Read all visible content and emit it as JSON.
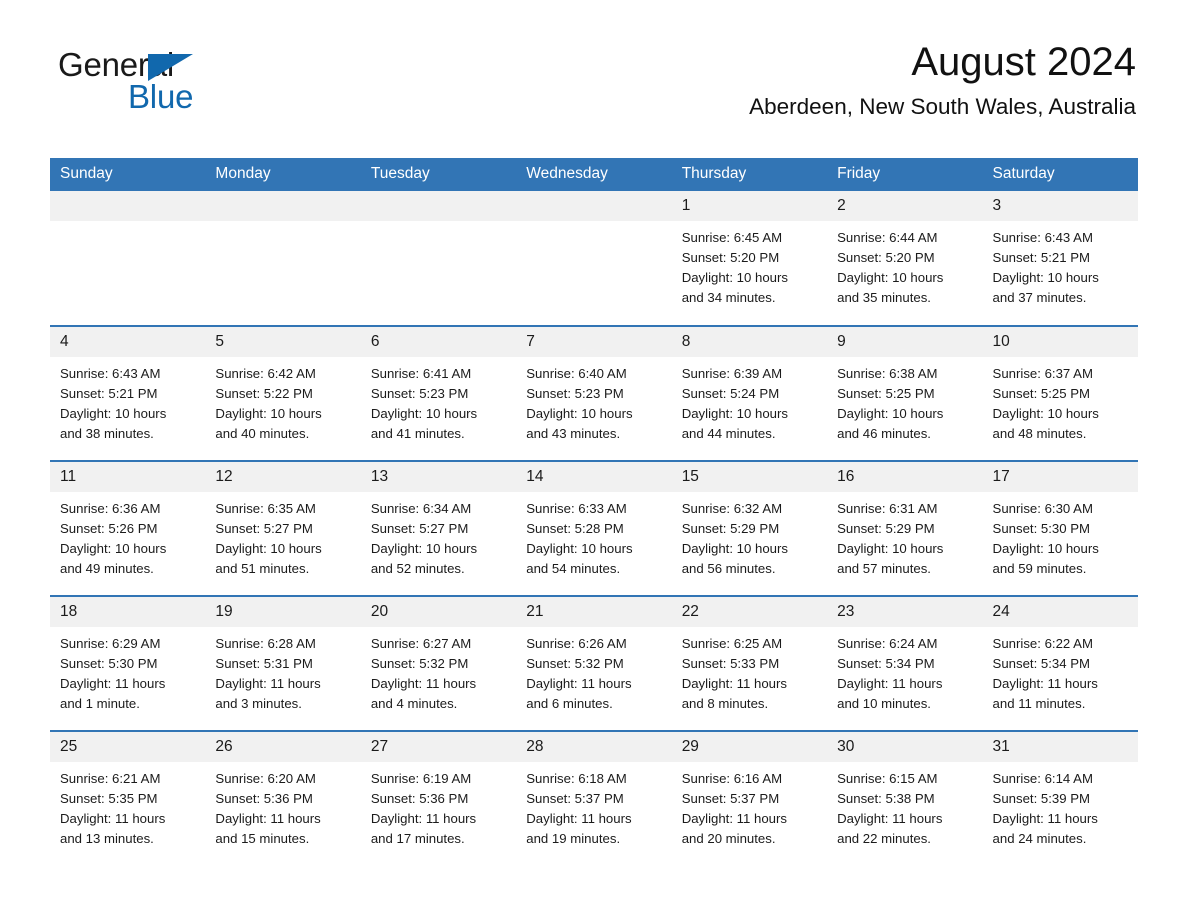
{
  "brand": {
    "name_part1": "General",
    "name_part2": "Blue",
    "accent_color": "#1168ad",
    "triangle_icon": "triangle-icon"
  },
  "header": {
    "month_title": "August 2024",
    "location": "Aberdeen, New South Wales, Australia"
  },
  "theme": {
    "header_blue": "#3275b5",
    "row_divider_blue": "#3275b5",
    "daynum_band": "#f1f1f1",
    "text": "#1b1b1b"
  },
  "calendar": {
    "weekday_headers": [
      "Sunday",
      "Monday",
      "Tuesday",
      "Wednesday",
      "Thursday",
      "Friday",
      "Saturday"
    ],
    "weeks": [
      [
        {
          "day": "",
          "empty": true,
          "sunrise": "",
          "sunset": "",
          "daylight_line1": "",
          "daylight_line2": ""
        },
        {
          "day": "",
          "empty": true,
          "sunrise": "",
          "sunset": "",
          "daylight_line1": "",
          "daylight_line2": ""
        },
        {
          "day": "",
          "empty": true,
          "sunrise": "",
          "sunset": "",
          "daylight_line1": "",
          "daylight_line2": ""
        },
        {
          "day": "",
          "empty": true,
          "sunrise": "",
          "sunset": "",
          "daylight_line1": "",
          "daylight_line2": ""
        },
        {
          "day": "1",
          "empty": false,
          "sunrise": "Sunrise: 6:45 AM",
          "sunset": "Sunset: 5:20 PM",
          "daylight_line1": "Daylight: 10 hours",
          "daylight_line2": "and 34 minutes."
        },
        {
          "day": "2",
          "empty": false,
          "sunrise": "Sunrise: 6:44 AM",
          "sunset": "Sunset: 5:20 PM",
          "daylight_line1": "Daylight: 10 hours",
          "daylight_line2": "and 35 minutes."
        },
        {
          "day": "3",
          "empty": false,
          "sunrise": "Sunrise: 6:43 AM",
          "sunset": "Sunset: 5:21 PM",
          "daylight_line1": "Daylight: 10 hours",
          "daylight_line2": "and 37 minutes."
        }
      ],
      [
        {
          "day": "4",
          "empty": false,
          "sunrise": "Sunrise: 6:43 AM",
          "sunset": "Sunset: 5:21 PM",
          "daylight_line1": "Daylight: 10 hours",
          "daylight_line2": "and 38 minutes."
        },
        {
          "day": "5",
          "empty": false,
          "sunrise": "Sunrise: 6:42 AM",
          "sunset": "Sunset: 5:22 PM",
          "daylight_line1": "Daylight: 10 hours",
          "daylight_line2": "and 40 minutes."
        },
        {
          "day": "6",
          "empty": false,
          "sunrise": "Sunrise: 6:41 AM",
          "sunset": "Sunset: 5:23 PM",
          "daylight_line1": "Daylight: 10 hours",
          "daylight_line2": "and 41 minutes."
        },
        {
          "day": "7",
          "empty": false,
          "sunrise": "Sunrise: 6:40 AM",
          "sunset": "Sunset: 5:23 PM",
          "daylight_line1": "Daylight: 10 hours",
          "daylight_line2": "and 43 minutes."
        },
        {
          "day": "8",
          "empty": false,
          "sunrise": "Sunrise: 6:39 AM",
          "sunset": "Sunset: 5:24 PM",
          "daylight_line1": "Daylight: 10 hours",
          "daylight_line2": "and 44 minutes."
        },
        {
          "day": "9",
          "empty": false,
          "sunrise": "Sunrise: 6:38 AM",
          "sunset": "Sunset: 5:25 PM",
          "daylight_line1": "Daylight: 10 hours",
          "daylight_line2": "and 46 minutes."
        },
        {
          "day": "10",
          "empty": false,
          "sunrise": "Sunrise: 6:37 AM",
          "sunset": "Sunset: 5:25 PM",
          "daylight_line1": "Daylight: 10 hours",
          "daylight_line2": "and 48 minutes."
        }
      ],
      [
        {
          "day": "11",
          "empty": false,
          "sunrise": "Sunrise: 6:36 AM",
          "sunset": "Sunset: 5:26 PM",
          "daylight_line1": "Daylight: 10 hours",
          "daylight_line2": "and 49 minutes."
        },
        {
          "day": "12",
          "empty": false,
          "sunrise": "Sunrise: 6:35 AM",
          "sunset": "Sunset: 5:27 PM",
          "daylight_line1": "Daylight: 10 hours",
          "daylight_line2": "and 51 minutes."
        },
        {
          "day": "13",
          "empty": false,
          "sunrise": "Sunrise: 6:34 AM",
          "sunset": "Sunset: 5:27 PM",
          "daylight_line1": "Daylight: 10 hours",
          "daylight_line2": "and 52 minutes."
        },
        {
          "day": "14",
          "empty": false,
          "sunrise": "Sunrise: 6:33 AM",
          "sunset": "Sunset: 5:28 PM",
          "daylight_line1": "Daylight: 10 hours",
          "daylight_line2": "and 54 minutes."
        },
        {
          "day": "15",
          "empty": false,
          "sunrise": "Sunrise: 6:32 AM",
          "sunset": "Sunset: 5:29 PM",
          "daylight_line1": "Daylight: 10 hours",
          "daylight_line2": "and 56 minutes."
        },
        {
          "day": "16",
          "empty": false,
          "sunrise": "Sunrise: 6:31 AM",
          "sunset": "Sunset: 5:29 PM",
          "daylight_line1": "Daylight: 10 hours",
          "daylight_line2": "and 57 minutes."
        },
        {
          "day": "17",
          "empty": false,
          "sunrise": "Sunrise: 6:30 AM",
          "sunset": "Sunset: 5:30 PM",
          "daylight_line1": "Daylight: 10 hours",
          "daylight_line2": "and 59 minutes."
        }
      ],
      [
        {
          "day": "18",
          "empty": false,
          "sunrise": "Sunrise: 6:29 AM",
          "sunset": "Sunset: 5:30 PM",
          "daylight_line1": "Daylight: 11 hours",
          "daylight_line2": "and 1 minute."
        },
        {
          "day": "19",
          "empty": false,
          "sunrise": "Sunrise: 6:28 AM",
          "sunset": "Sunset: 5:31 PM",
          "daylight_line1": "Daylight: 11 hours",
          "daylight_line2": "and 3 minutes."
        },
        {
          "day": "20",
          "empty": false,
          "sunrise": "Sunrise: 6:27 AM",
          "sunset": "Sunset: 5:32 PM",
          "daylight_line1": "Daylight: 11 hours",
          "daylight_line2": "and 4 minutes."
        },
        {
          "day": "21",
          "empty": false,
          "sunrise": "Sunrise: 6:26 AM",
          "sunset": "Sunset: 5:32 PM",
          "daylight_line1": "Daylight: 11 hours",
          "daylight_line2": "and 6 minutes."
        },
        {
          "day": "22",
          "empty": false,
          "sunrise": "Sunrise: 6:25 AM",
          "sunset": "Sunset: 5:33 PM",
          "daylight_line1": "Daylight: 11 hours",
          "daylight_line2": "and 8 minutes."
        },
        {
          "day": "23",
          "empty": false,
          "sunrise": "Sunrise: 6:24 AM",
          "sunset": "Sunset: 5:34 PM",
          "daylight_line1": "Daylight: 11 hours",
          "daylight_line2": "and 10 minutes."
        },
        {
          "day": "24",
          "empty": false,
          "sunrise": "Sunrise: 6:22 AM",
          "sunset": "Sunset: 5:34 PM",
          "daylight_line1": "Daylight: 11 hours",
          "daylight_line2": "and 11 minutes."
        }
      ],
      [
        {
          "day": "25",
          "empty": false,
          "sunrise": "Sunrise: 6:21 AM",
          "sunset": "Sunset: 5:35 PM",
          "daylight_line1": "Daylight: 11 hours",
          "daylight_line2": "and 13 minutes."
        },
        {
          "day": "26",
          "empty": false,
          "sunrise": "Sunrise: 6:20 AM",
          "sunset": "Sunset: 5:36 PM",
          "daylight_line1": "Daylight: 11 hours",
          "daylight_line2": "and 15 minutes."
        },
        {
          "day": "27",
          "empty": false,
          "sunrise": "Sunrise: 6:19 AM",
          "sunset": "Sunset: 5:36 PM",
          "daylight_line1": "Daylight: 11 hours",
          "daylight_line2": "and 17 minutes."
        },
        {
          "day": "28",
          "empty": false,
          "sunrise": "Sunrise: 6:18 AM",
          "sunset": "Sunset: 5:37 PM",
          "daylight_line1": "Daylight: 11 hours",
          "daylight_line2": "and 19 minutes."
        },
        {
          "day": "29",
          "empty": false,
          "sunrise": "Sunrise: 6:16 AM",
          "sunset": "Sunset: 5:37 PM",
          "daylight_line1": "Daylight: 11 hours",
          "daylight_line2": "and 20 minutes."
        },
        {
          "day": "30",
          "empty": false,
          "sunrise": "Sunrise: 6:15 AM",
          "sunset": "Sunset: 5:38 PM",
          "daylight_line1": "Daylight: 11 hours",
          "daylight_line2": "and 22 minutes."
        },
        {
          "day": "31",
          "empty": false,
          "sunrise": "Sunrise: 6:14 AM",
          "sunset": "Sunset: 5:39 PM",
          "daylight_line1": "Daylight: 11 hours",
          "daylight_line2": "and 24 minutes."
        }
      ]
    ]
  }
}
